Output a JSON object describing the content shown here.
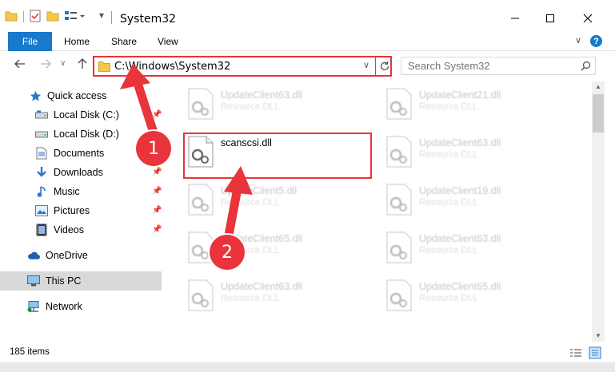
{
  "window": {
    "title": "System32",
    "min_symbol": "—",
    "max_symbol": "☐",
    "close_symbol": "✕"
  },
  "ribbon": {
    "tabs": [
      "File",
      "Home",
      "Share",
      "View"
    ],
    "help": "?",
    "collapse": "∨"
  },
  "address": {
    "path": "C:\\Windows\\System32"
  },
  "search": {
    "placeholder": "Search System32"
  },
  "sidebar": {
    "items": [
      {
        "label": "Quick access",
        "icon": "star-icon"
      },
      {
        "label": "Local Disk (C:)",
        "icon": "drive-icon"
      },
      {
        "label": "Local Disk (D:)",
        "icon": "drive-icon"
      },
      {
        "label": "Documents",
        "icon": "documents-icon"
      },
      {
        "label": "Downloads",
        "icon": "downloads-icon"
      },
      {
        "label": "Music",
        "icon": "music-icon"
      },
      {
        "label": "Pictures",
        "icon": "pictures-icon"
      },
      {
        "label": "Videos",
        "icon": "videos-icon"
      },
      {
        "label": "OneDrive",
        "icon": "cloud-icon"
      },
      {
        "label": "This PC",
        "icon": "computer-icon"
      },
      {
        "label": "Network",
        "icon": "network-icon"
      }
    ]
  },
  "files": [
    {
      "name": "UpdateClient63.dll",
      "type": "Resource DLL"
    },
    {
      "name": "UpdateClient21.dll",
      "type": "Resource DLL"
    },
    {
      "name": "scanscsi.dll",
      "type": ""
    },
    {
      "name": "UpdateClient63.dll",
      "type": "Resource DLL"
    },
    {
      "name": "UpdateClient5.dll",
      "type": "Resource DLL"
    },
    {
      "name": "UpdateClient19.dll",
      "type": "Resource DLL"
    },
    {
      "name": "UpdateClient65.dll",
      "type": "Resource DLL"
    },
    {
      "name": "UpdateClient63.dll",
      "type": "Resource DLL"
    },
    {
      "name": "UpdateClient63.dll",
      "type": "Resource DLL"
    },
    {
      "name": "UpdateClient65.dll",
      "type": "Resource DLL"
    }
  ],
  "status": {
    "item_count": "185 items"
  },
  "annotations": {
    "step1": "1",
    "step2": "2"
  },
  "colors": {
    "accent": "#1979ca",
    "highlight": "#e8343a"
  }
}
